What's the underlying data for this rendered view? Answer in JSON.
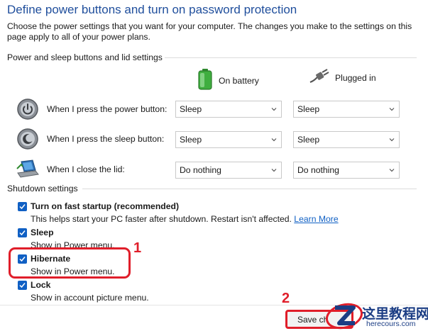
{
  "header": {
    "title": "Define power buttons and turn on password protection",
    "intro": "Choose the power settings that you want for your computer. The changes you make to the settings on this page apply to all of your power plans."
  },
  "power_section": {
    "heading": "Power and sleep buttons and lid settings",
    "col_battery": "On battery",
    "col_plugged": "Plugged in",
    "rows": [
      {
        "label": "When I press the power button:",
        "battery": "Sleep",
        "plugged": "Sleep",
        "icon": "power-icon"
      },
      {
        "label": "When I press the sleep button:",
        "battery": "Sleep",
        "plugged": "Sleep",
        "icon": "sleep-icon"
      },
      {
        "label": "When I close the lid:",
        "battery": "Do nothing",
        "plugged": "Do nothing",
        "icon": "laptop-lid-icon"
      }
    ]
  },
  "shutdown_section": {
    "heading": "Shutdown settings",
    "items": [
      {
        "title": "Turn on fast startup (recommended)",
        "desc": "This helps start your PC faster after shutdown. Restart isn't affected.",
        "link": "Learn More",
        "checked": true
      },
      {
        "title": "Sleep",
        "desc": "Show in Power menu.",
        "checked": true
      },
      {
        "title": "Hibernate",
        "desc": "Show in Power menu.",
        "checked": true
      },
      {
        "title": "Lock",
        "desc": "Show in account picture menu.",
        "checked": true
      }
    ]
  },
  "annotations": {
    "one": "1",
    "two": "2"
  },
  "footer": {
    "save_label": "Save ch"
  },
  "watermark": {
    "chinese": "这里教程网",
    "url": "herecours.com"
  },
  "colors": {
    "title_blue": "#1f4e9c",
    "checkbox_blue": "#1060c4",
    "annotation_red": "#e01e2a"
  }
}
